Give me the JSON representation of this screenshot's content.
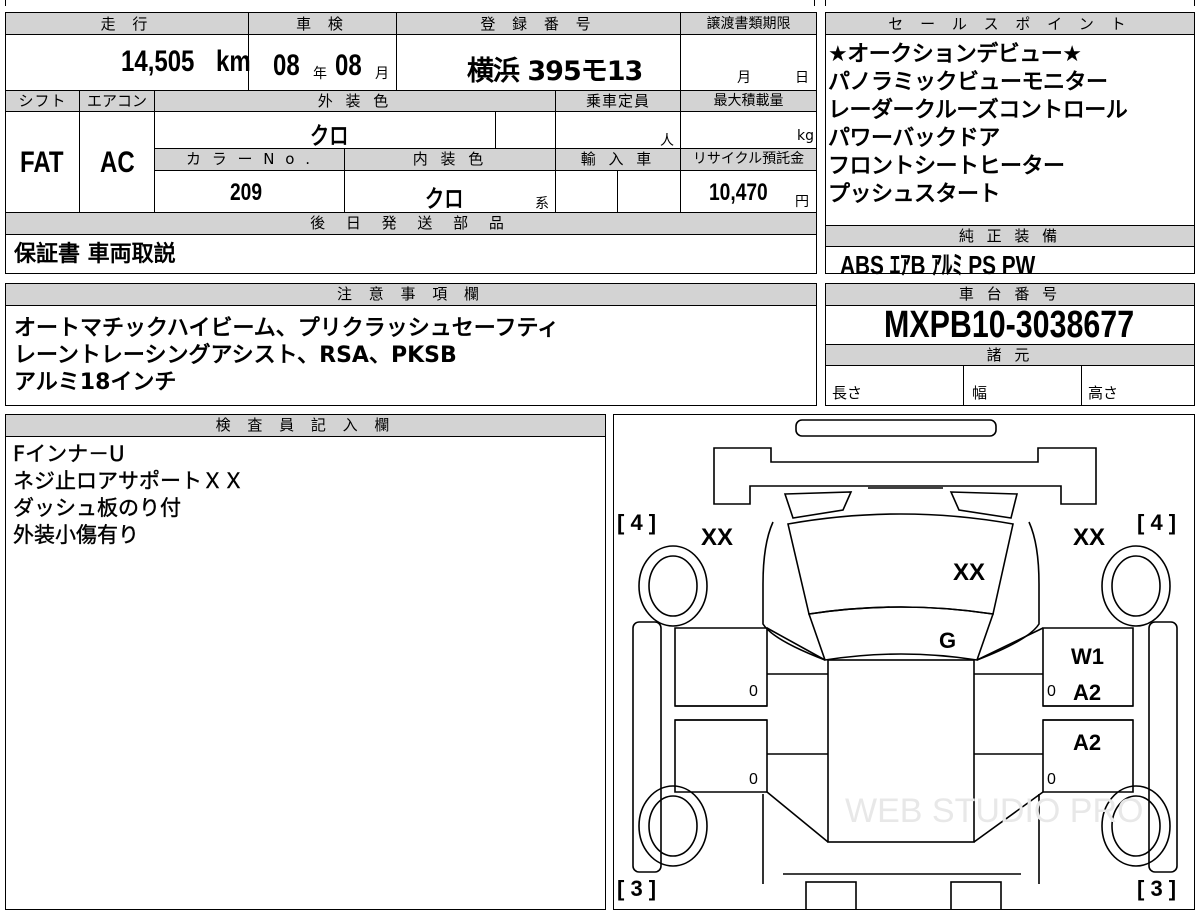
{
  "specs": {
    "headers": {
      "mileage": "走 行",
      "inspection": "車 検",
      "registration": "登 録 番 号",
      "transfer_deadline": "譲渡書類期限",
      "shift": "シフト",
      "aircon": "エアコン",
      "exterior_color": "外 装 色",
      "capacity": "乗車定員",
      "max_load": "最大積載量",
      "color_no": "カ ラ ー N o .",
      "interior_color": "内 装 色",
      "import": "輸 入 車",
      "recycle": "リサイクル預託金"
    },
    "mileage_value": "14,505",
    "mileage_unit": "km",
    "inspection_year": "08",
    "inspection_year_unit": "年",
    "inspection_month": "08",
    "inspection_month_unit": "月",
    "registration_value": "横浜 395モ13",
    "transfer_month_unit": "月",
    "transfer_day_unit": "日",
    "shift_value": "FAT",
    "aircon_value": "AC",
    "exterior_color_value": "クロ",
    "capacity_unit": "人",
    "max_load_unit": "kg",
    "color_no_value": "209",
    "interior_color_value": "クロ",
    "interior_color_suffix": "系",
    "recycle_value": "10,470",
    "recycle_unit": "円"
  },
  "later_parts": {
    "header": "後 日 発 送 部 品",
    "value": "保証書 車両取説"
  },
  "sales_points": {
    "header": "セ ー ル ス ポ イ ン ト",
    "items": [
      "★オークションデビュー★",
      "パノラミックビューモニター",
      "レーダークルーズコントロール",
      "パワーバックドア",
      "フロントシートヒーター",
      "プッシュスタート"
    ]
  },
  "genuine_equipment": {
    "header": "純 正 装 備",
    "value": "ABS ｴｱB ｱﾙﾐ PS PW"
  },
  "notes": {
    "header": "注 意 事 項 欄",
    "lines": [
      "オートマチックハイビーム、プリクラッシュセーフティ",
      "レーントレーシングアシスト、RSA、PKSB",
      "アルミ18インチ"
    ]
  },
  "chassis": {
    "header": "車 台 番 号",
    "value": "MXPB10-3038677",
    "specs_header": "諸 元",
    "length_label": "長さ",
    "width_label": "幅",
    "height_label": "高さ"
  },
  "inspector": {
    "header": "検 査 員 記 入 欄",
    "lines": [
      "Fインナ－U",
      "ネジ止ロアサポートＸＸ",
      "ダッシュ板のり付",
      "外装小傷有り"
    ]
  },
  "diagram": {
    "tire_fl": "[ 4 ]",
    "tire_fr": "[ 4 ]",
    "tire_rl": "[ 3 ]",
    "tire_rr": "[ 3 ]",
    "mark_fender_left": "XX",
    "mark_fender_right": "XX",
    "mark_hood": "XX",
    "mark_windshield": "G",
    "mark_front_door_right_1": "W1",
    "mark_front_door_right_2": "A2",
    "mark_rear_door_right": "A2",
    "mark_door_fl": "0",
    "mark_door_rl": "0",
    "mark_door_fr": "0",
    "mark_door_rr": "0"
  },
  "watermark": "WEB STUDIO PRO"
}
